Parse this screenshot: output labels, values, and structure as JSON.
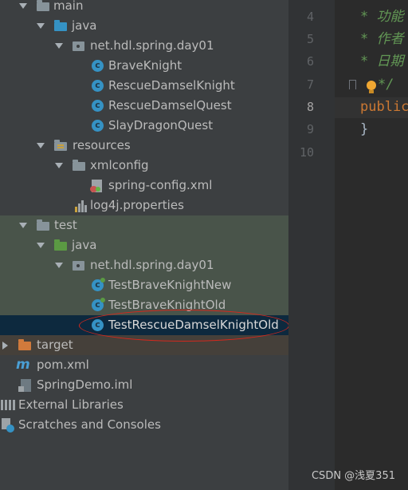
{
  "project_tree": {
    "items": [
      {
        "label": "main",
        "icon": "folder-icon"
      },
      {
        "label": "java",
        "icon": "source-folder-icon"
      },
      {
        "label": "net.hdl.spring.day01",
        "icon": "package-icon"
      },
      {
        "label": "BraveKnight",
        "icon": "class-icon"
      },
      {
        "label": "RescueDamselKnight",
        "icon": "class-icon"
      },
      {
        "label": "RescueDamselQuest",
        "icon": "class-icon"
      },
      {
        "label": "SlayDragonQuest",
        "icon": "class-icon"
      },
      {
        "label": "resources",
        "icon": "resources-folder-icon"
      },
      {
        "label": "xmlconfig",
        "icon": "folder-icon"
      },
      {
        "label": "spring-config.xml",
        "icon": "xml-file-icon"
      },
      {
        "label": "log4j.properties",
        "icon": "properties-file-icon"
      },
      {
        "label": "test",
        "icon": "folder-icon"
      },
      {
        "label": "java",
        "icon": "test-source-folder-icon"
      },
      {
        "label": "net.hdl.spring.day01",
        "icon": "package-icon"
      },
      {
        "label": "TestBraveKnightNew",
        "icon": "test-class-icon"
      },
      {
        "label": "TestBraveKnightOld",
        "icon": "test-class-icon"
      },
      {
        "label": "TestRescueDamselKnightOld",
        "icon": "class-icon",
        "selected": true
      },
      {
        "label": "target",
        "icon": "excluded-folder-icon"
      },
      {
        "label": "pom.xml",
        "icon": "maven-icon"
      },
      {
        "label": "SpringDemo.iml",
        "icon": "iml-file-icon"
      },
      {
        "label": "External Libraries",
        "icon": "libraries-icon"
      },
      {
        "label": "Scratches and Consoles",
        "icon": "scratches-icon"
      }
    ]
  },
  "editor": {
    "line_numbers": [
      "4",
      "5",
      "6",
      "7",
      "8",
      "9",
      "10"
    ],
    "current_line": "8",
    "lines": [
      {
        "text": "* 功能",
        "style": "comment"
      },
      {
        "text": "* 作者",
        "style": "comment"
      },
      {
        "text": "* 日期",
        "style": "comment"
      },
      {
        "text": "*/",
        "style": "comment"
      },
      {
        "text": "public",
        "style": "keyword"
      },
      {
        "text": "}",
        "style": "bracket"
      },
      {
        "text": "",
        "style": "plain"
      }
    ]
  },
  "watermark": "CSDN @浅夏351",
  "colors": {
    "panel_bg": "#3c3f41",
    "editor_bg": "#2b2b2b",
    "selection": "#0d293e",
    "test_highlight": "#49544a",
    "excluded_highlight": "#45403a",
    "annotation_ellipse": "#d4281d"
  }
}
